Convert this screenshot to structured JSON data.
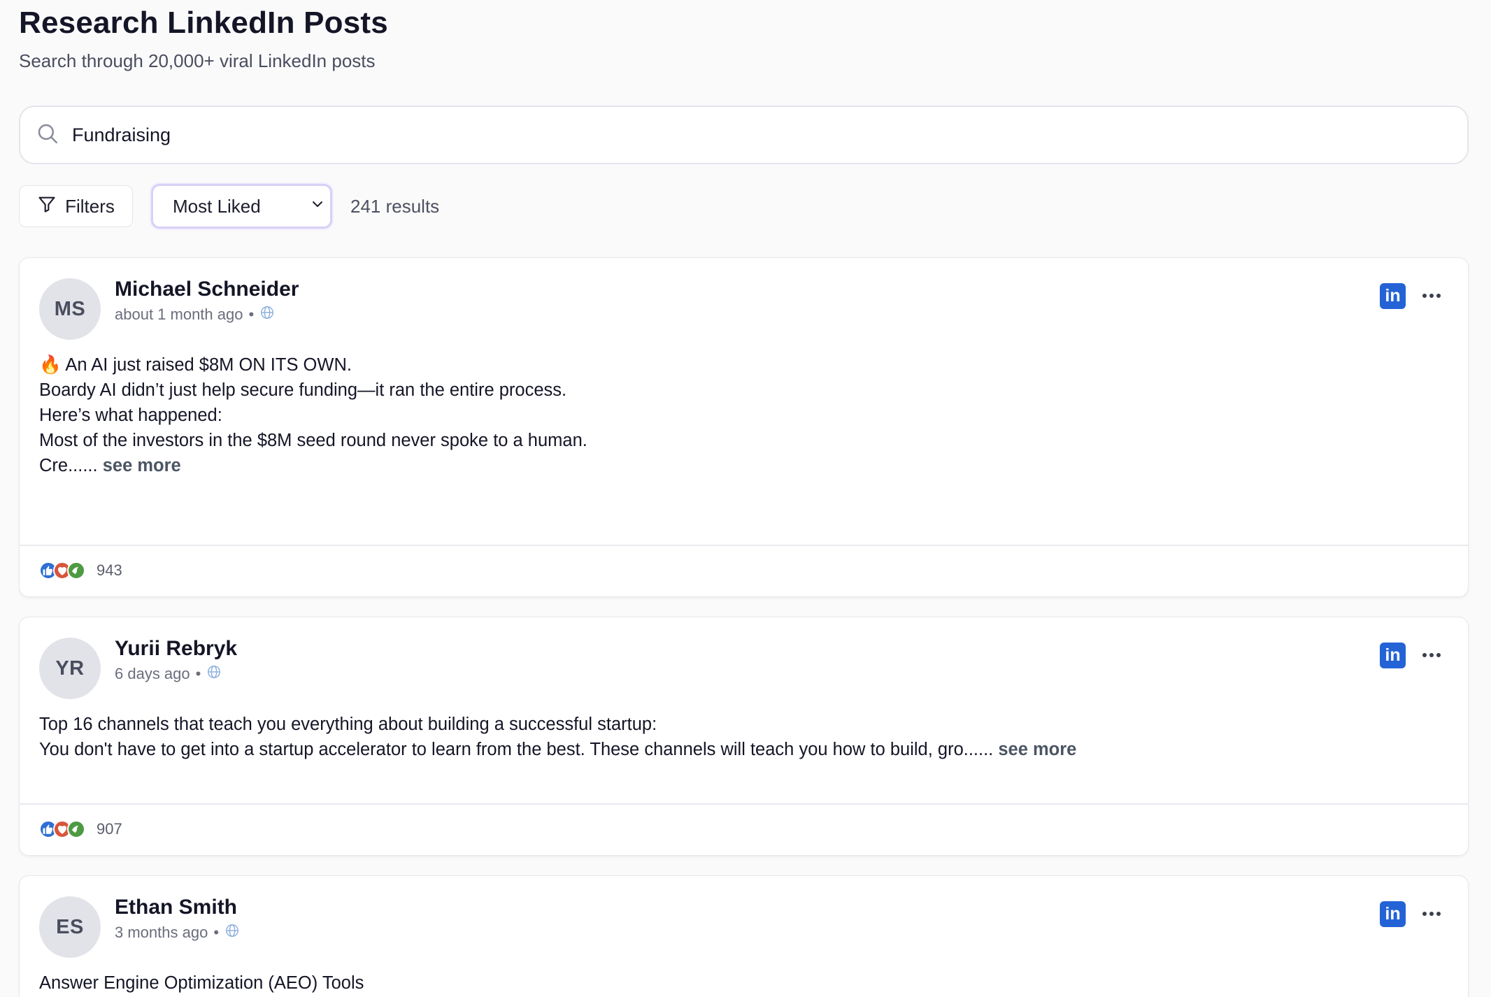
{
  "header": {
    "title": "Research LinkedIn Posts",
    "subtitle": "Search through 20,000+ viral LinkedIn posts"
  },
  "search": {
    "value": "Fundraising",
    "icon": "search-icon"
  },
  "toolbar": {
    "filters_label": "Filters",
    "sort_selected": "Most Liked",
    "results_count": "241 results"
  },
  "colors": {
    "accent_border": "#d9d0f6",
    "linkedin_blue": "#2463d6"
  },
  "posts": [
    {
      "initials": "MS",
      "author": "Michael Schneider",
      "time": "about 1 month ago",
      "separator": "•",
      "visibility_icon": "globe-icon",
      "lines": [
        "🔥 An AI just raised $8M ON ITS OWN.",
        "",
        "Boardy AI didn’t just help secure funding—it ran the entire process.",
        "Here’s what happened:",
        "",
        "Most of the investors in the $8M seed round never spoke to a human.",
        "Cre......"
      ],
      "see_more": "see more",
      "reactions": "943"
    },
    {
      "initials": "YR",
      "author": "Yurii Rebryk",
      "time": "6 days ago",
      "separator": "•",
      "visibility_icon": "globe-icon",
      "lines": [
        "Top 16 channels that teach you everything about building a successful startup:",
        "",
        "You don't have to get into a startup accelerator to learn from the best. These channels will teach you how to build, gro......"
      ],
      "see_more": "see more",
      "reactions": "907"
    },
    {
      "initials": "ES",
      "author": "Ethan Smith",
      "time": "3 months ago",
      "separator": "•",
      "visibility_icon": "globe-icon",
      "lines": [
        "Answer Engine Optimization (AEO) Tools"
      ]
    }
  ],
  "linkedin_badge": "in"
}
